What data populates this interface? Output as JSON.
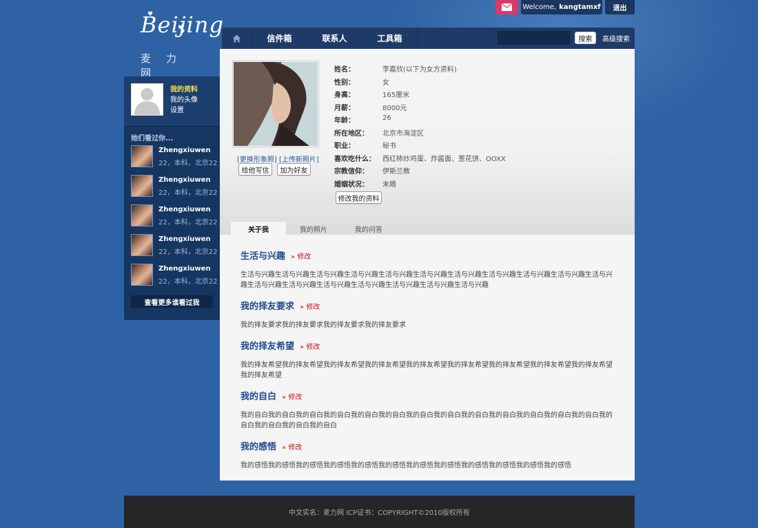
{
  "topbar": {
    "welcome_prefix": "Welcome,",
    "username": "kangtamxf",
    "logout": "退出"
  },
  "logo": {
    "word": "Beijing",
    "cn": "麦力网"
  },
  "nav": {
    "items": [
      "信件箱",
      "联系人",
      "工具箱"
    ],
    "search_placeholder": "",
    "search_button": "搜索",
    "advanced_search": "高级搜索"
  },
  "sidebar": {
    "links": [
      "我的资料",
      "我的头像",
      "设置"
    ],
    "viewed_title": "她们看过你...",
    "viewers": [
      {
        "name": "Zhengxiuwen",
        "info": "22，本科，北京22..."
      },
      {
        "name": "Zhengxiuwen",
        "info": "22，本科，北京22..."
      },
      {
        "name": "Zhengxiuwen",
        "info": "22，本科，北京22..."
      },
      {
        "name": "Zhengxiuwen",
        "info": "22，本科，北京22..."
      },
      {
        "name": "Zhengxiuwen",
        "info": "22，本科，北京22..."
      }
    ],
    "more_button": "查看更多谁看过我"
  },
  "profile": {
    "change_photo": "[更换形象照]",
    "upload_photo": "[上传新照片]",
    "write_button": "给他写信",
    "add_friend_button": "加为好友",
    "fields": [
      {
        "label": "姓名：",
        "value": "李嘉欣(以下为女方资料)"
      },
      {
        "label": "性别：",
        "value": "女"
      },
      {
        "label": "身高：",
        "value": "165厘米"
      },
      {
        "label": "月薪：",
        "value": "8000元"
      },
      {
        "label": "年龄：",
        "value": "26"
      },
      {
        "label": "所在地区：",
        "value": "北京市海淀区"
      },
      {
        "label": "职业：",
        "value": "秘书"
      },
      {
        "label": "喜欢吃什么：",
        "value": "西红柿炒鸡蛋、炸酱面、葱花饼、OOXX"
      },
      {
        "label": "宗教信仰：",
        "value": "伊斯兰教"
      },
      {
        "label": "婚姻状况：",
        "value": "未婚"
      }
    ],
    "edit_button": "修改我的资料"
  },
  "tabs": [
    "关于我",
    "我的照片",
    "我的问答"
  ],
  "sections": [
    {
      "title": "生活与兴趣",
      "edit": "» 修改",
      "body": "生活与兴趣生活与兴趣生活与兴趣生活与兴趣生活与兴趣生活与兴趣生活与兴趣生活与兴趣生活与兴趣生活与兴趣生活与兴趣生活与兴趣生活与兴趣生活与兴趣生活与兴趣生活与兴趣生活与兴趣生活与兴趣"
    },
    {
      "title": "我的择友要求",
      "edit": "» 修改",
      "body": "我的择友要求我的择友要求我的择友要求我的择友要求"
    },
    {
      "title": "我的择友希望",
      "edit": "» 修改",
      "body": "我的择友希望我的择友希望我的择友希望我的择友希望我的择友希望我的择友希望我的择友希望我的择友希望我的择友希望我的择友希望"
    },
    {
      "title": "我的自白",
      "edit": "» 修改",
      "body": "我的自白我的自白我的自白我的自白我的自白我的自白我的自白我的自白我的自白我的自白我的自白我的自白我的自白我的自白我的自白我的自白我的自白"
    },
    {
      "title": "我的感悟",
      "edit": "» 修改",
      "body": "我的感悟我的感悟我的感悟我的感悟我的感悟我的感悟我的感悟我的感悟我的感悟我的感悟我的感悟我的感悟"
    }
  ],
  "footer": {
    "text": "中文实名：麦力网 ICP证书：COPYRIGHT©2010版权所有"
  }
}
